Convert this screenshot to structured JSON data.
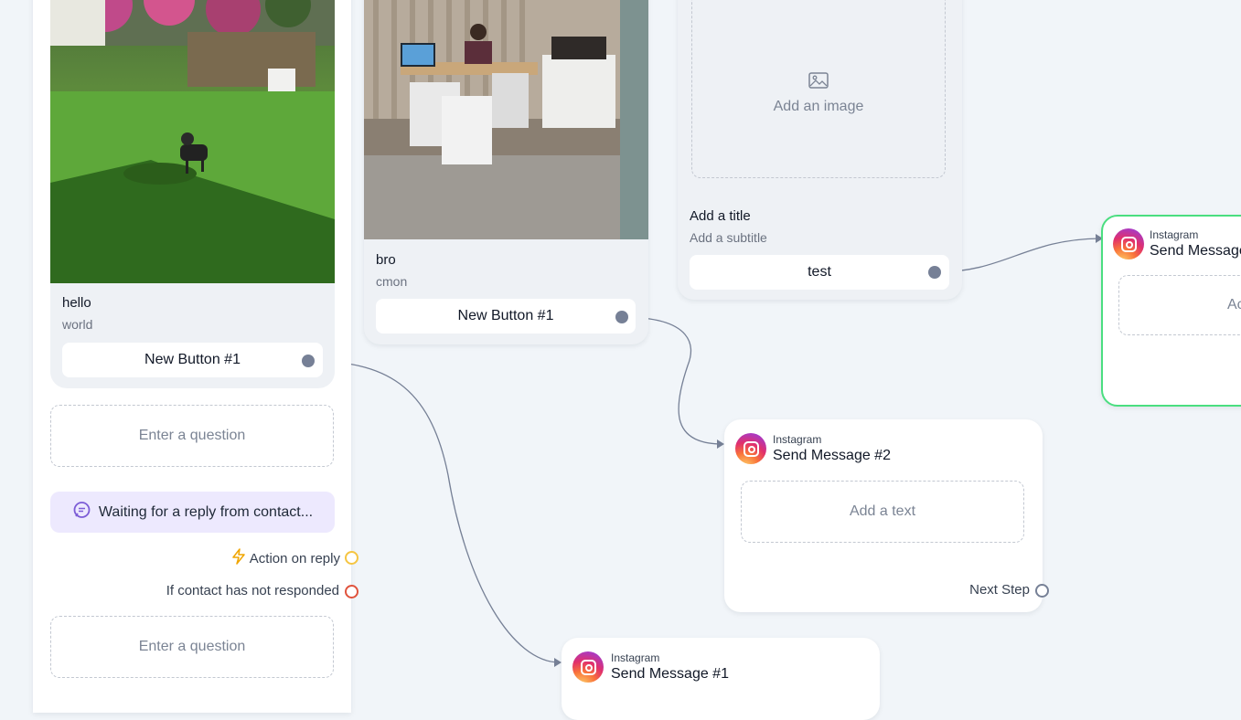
{
  "cards": [
    {
      "title": "hello",
      "subtitle": "world",
      "button": "New Button #1"
    },
    {
      "title": "bro",
      "subtitle": "cmon",
      "button": "New Button #1"
    },
    {
      "image_placeholder": "Add an image",
      "title": "Add a title",
      "subtitle": "Add a subtitle",
      "button": "test"
    }
  ],
  "question_nodes": {
    "question_placeholder_1": "Enter a question",
    "waiting_text": "Waiting for a reply from contact...",
    "action_on_reply": "Action on reply",
    "not_responded": "If contact has not responded",
    "question_placeholder_2": "Enter a question"
  },
  "instagram_nodes": [
    {
      "platform": "Instagram",
      "title": "Send Message #2",
      "text_placeholder": "Add a text",
      "next_step": "Next Step"
    },
    {
      "platform": "Instagram",
      "title": "Send Message #1"
    },
    {
      "platform": "Instagram",
      "title": "Send Message",
      "text_placeholder": "Ac"
    }
  ],
  "colors": {
    "canvas": "#f1f5f9",
    "edge": "#768096",
    "action_ring": "#f5c542",
    "noresponse_ring": "#e0533d",
    "selected_border": "#4ade80",
    "waiting_bg": "#ede9fe"
  },
  "icons": [
    "image-icon",
    "chat-bubble-icon",
    "lightning-icon",
    "instagram-icon"
  ]
}
